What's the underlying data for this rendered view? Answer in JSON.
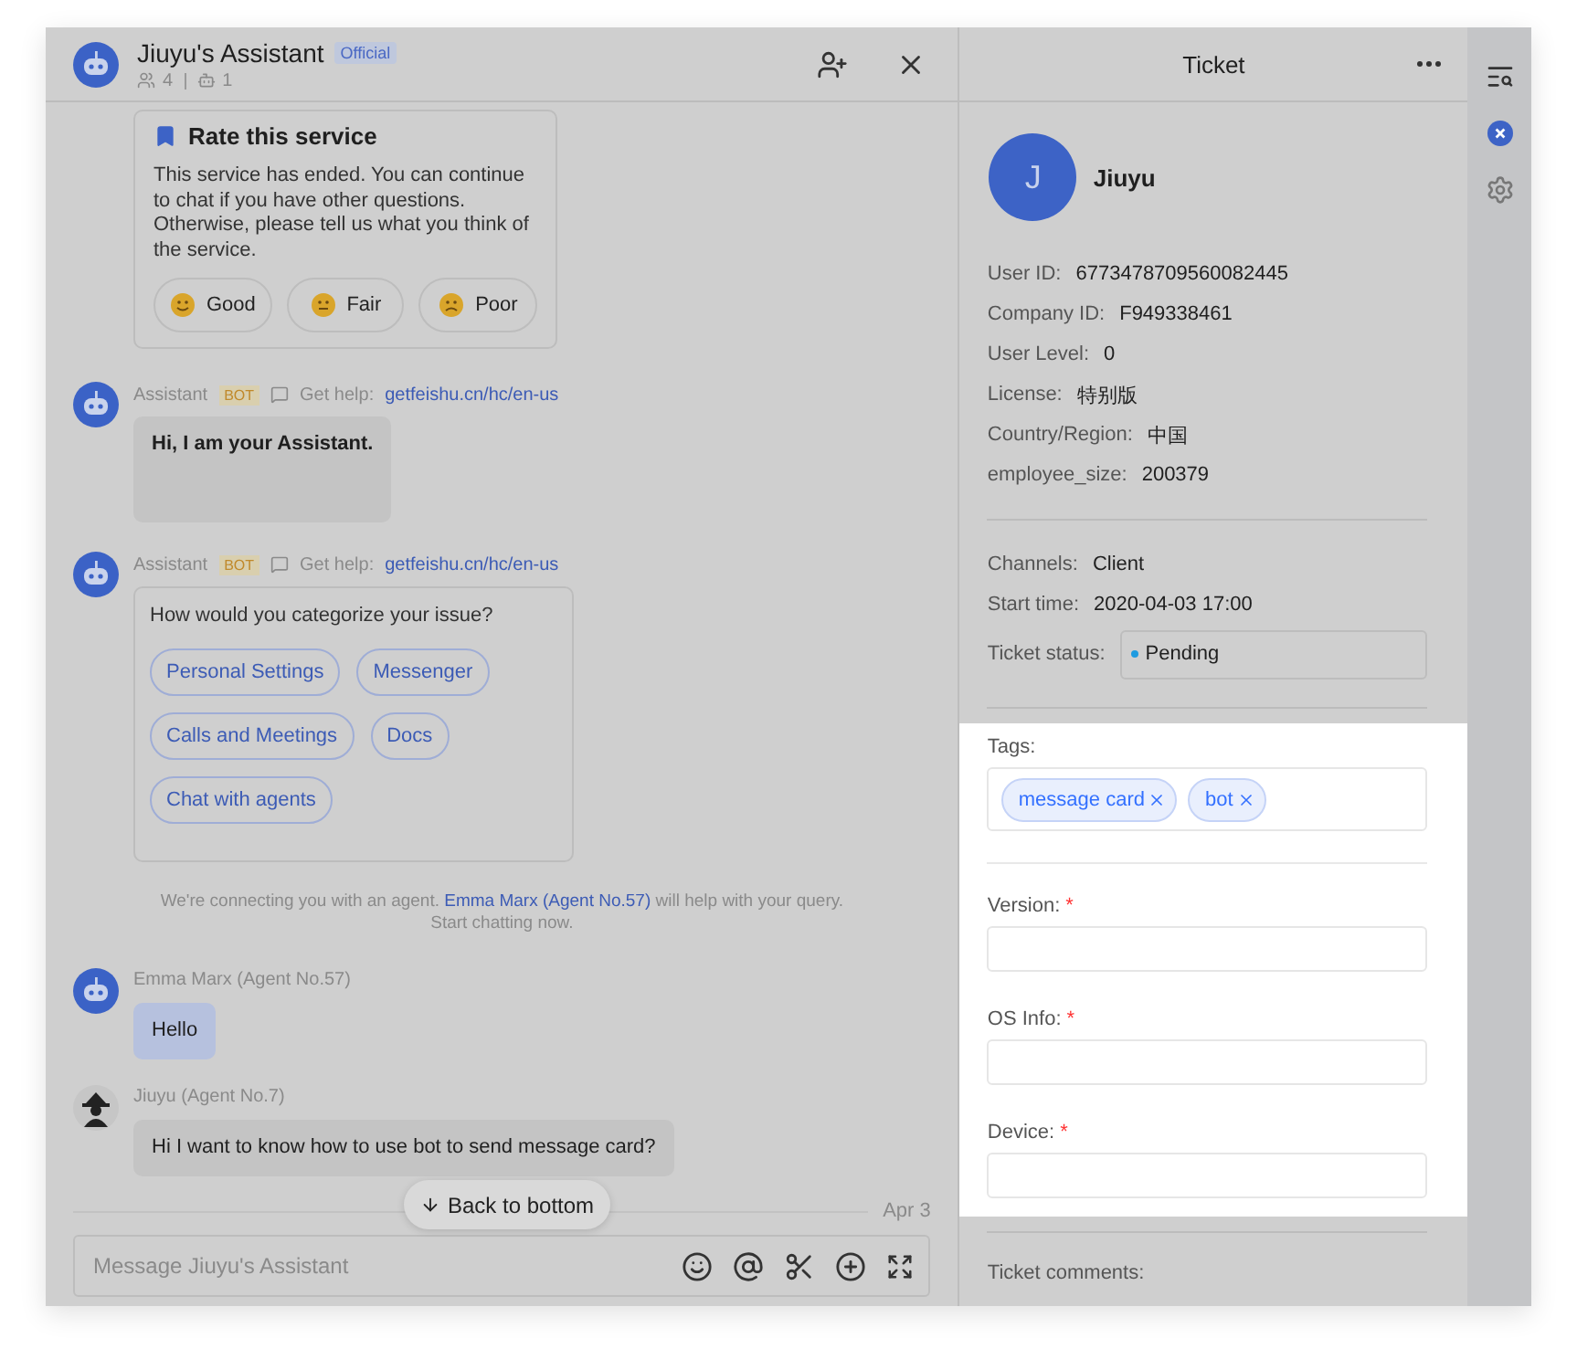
{
  "chat": {
    "header": {
      "title": "Jiuyu's Assistant",
      "badge": "Official",
      "members": "4",
      "bots": "1"
    },
    "messages": [
      {
        "kind": "rating",
        "title": "Rate this service",
        "text": "This service has ended. You can continue to chat if you have other questions. Otherwise, please tell us what you think of the service.",
        "buttons": [
          {
            "label": "Good",
            "kind": "happy"
          },
          {
            "label": "Fair",
            "kind": "neutral"
          },
          {
            "label": "Poor",
            "kind": "sad"
          }
        ]
      },
      {
        "kind": "bot_text",
        "sender": "Assistant",
        "badge": "BOT",
        "help": "Get help:",
        "link": "getfeishu.cn/hc/en-us",
        "text": "Hi, I am your Assistant."
      },
      {
        "kind": "bot_options",
        "sender": "Assistant",
        "badge": "BOT",
        "help": "Get help:",
        "link": "getfeishu.cn/hc/en-us",
        "text": "How would you categorize your issue?",
        "options": [
          "Personal Settings",
          "Messenger",
          "Calls and Meetings",
          "Docs",
          "Chat with agents"
        ]
      },
      {
        "kind": "system",
        "before": "We're connecting you with an agent.",
        "link": "Emma Marx (Agent No.57)",
        "after": "will help with your query. Start chatting now."
      },
      {
        "kind": "bot_agent",
        "sender": "Emma Marx (Agent No.57)",
        "text": "Hello",
        "highlight": true
      },
      {
        "kind": "person_agent",
        "sender": "Jiuyu (Agent No.7)",
        "text": "Hi I want to know how to use bot to send message card?",
        "highlight": false
      }
    ],
    "back_to_bottom": "Back to bottom",
    "date": "Apr 3",
    "input": {
      "placeholder": "Message Jiuyu's Assistant"
    }
  },
  "ticket": {
    "title": "Ticket",
    "user": {
      "initial": "J",
      "name": "Jiuyu"
    },
    "info": [
      {
        "label": "User ID:",
        "value": "6773478709560082445"
      },
      {
        "label": "Company ID:",
        "value": "F949338461"
      },
      {
        "label": "User Level:",
        "value": "0"
      },
      {
        "label": "License:",
        "value": "特别版"
      },
      {
        "label": "Country/Region:",
        "value": "中国"
      },
      {
        "label": "employee_size:",
        "value": "200379"
      }
    ],
    "details": [
      {
        "label": "Channels:",
        "value": "Client"
      },
      {
        "label": "Start time:",
        "value": "2020-04-03 17:00"
      }
    ],
    "status": {
      "label": "Ticket status:",
      "value": "Pending",
      "color": "#1e9be0"
    },
    "form": {
      "highlighted": true,
      "tags_label": "Tags:",
      "tags": [
        "message card",
        "bot"
      ],
      "required_mark": "*",
      "fields": [
        {
          "label": "Version:",
          "required": true
        },
        {
          "label": "OS Info:",
          "required": true
        },
        {
          "label": "Device:",
          "required": true
        }
      ]
    },
    "comments_label": "Ticket comments:"
  }
}
